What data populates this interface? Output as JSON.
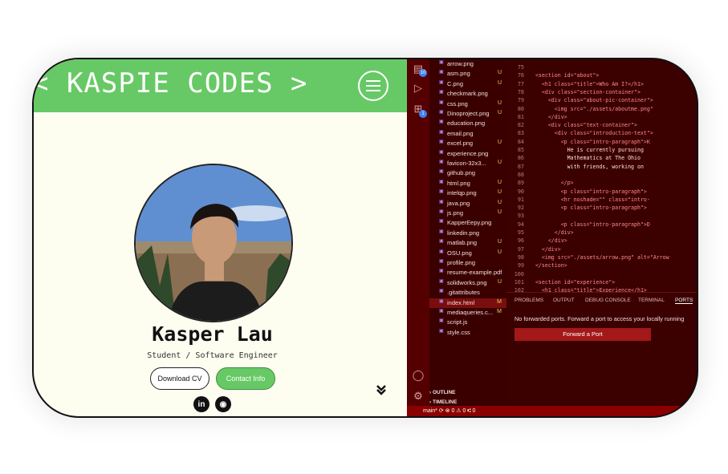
{
  "site": {
    "brand": "< KASPIE CODES >",
    "name": "Kasper Lau",
    "role": "Student / Software Engineer",
    "download_cv": "Download CV",
    "contact": "Contact Info",
    "linkedin": "in",
    "github": "◉",
    "scroll_icon": "⌄⌄"
  },
  "editor": {
    "activity": {
      "explorer_badge": "10",
      "extensions_badge": "1"
    },
    "files": [
      {
        "name": "arrow.png",
        "status": ""
      },
      {
        "name": "asm.png",
        "status": "U"
      },
      {
        "name": "C.png",
        "status": "U"
      },
      {
        "name": "checkmark.png",
        "status": ""
      },
      {
        "name": "css.png",
        "status": "U"
      },
      {
        "name": "Dinoproject.png",
        "status": "U"
      },
      {
        "name": "education.png",
        "status": ""
      },
      {
        "name": "email.png",
        "status": ""
      },
      {
        "name": "excel.png",
        "status": "U"
      },
      {
        "name": "experience.png",
        "status": ""
      },
      {
        "name": "favicon-32x3...",
        "status": "U"
      },
      {
        "name": "github.png",
        "status": ""
      },
      {
        "name": "html.png",
        "status": "U"
      },
      {
        "name": "intelqp.png",
        "status": "U"
      },
      {
        "name": "java.png",
        "status": "U"
      },
      {
        "name": "js.png",
        "status": "U"
      },
      {
        "name": "KapperEepy.png",
        "status": ""
      },
      {
        "name": "linkedin.png",
        "status": ""
      },
      {
        "name": "matlab.png",
        "status": "U"
      },
      {
        "name": "OSU.png",
        "status": "U"
      },
      {
        "name": "profile.png",
        "status": ""
      },
      {
        "name": "resume-example.pdf",
        "status": ""
      },
      {
        "name": "solidworks.png",
        "status": "U"
      },
      {
        "name": ".gitattributes",
        "status": ""
      },
      {
        "name": "index.html",
        "status": "M"
      },
      {
        "name": "mediaqueries.c...",
        "status": "M"
      },
      {
        "name": "script.js",
        "status": ""
      },
      {
        "name": "style.css",
        "status": ""
      }
    ],
    "line_numbers": [
      "75",
      "76",
      "77",
      "78",
      "79",
      "80",
      "81",
      "82",
      "83",
      "84",
      "85",
      "86",
      "87",
      "88",
      "89",
      "90",
      "91",
      "92",
      "93",
      "94",
      "95",
      "96",
      "97",
      "98",
      "99",
      "100",
      "101",
      "102"
    ],
    "code_lines": [
      "",
      "  <section id=\"about\">",
      "    <h1 class=\"title\">Who Am I?</h1>",
      "    <div class=\"section-container\">",
      "      <div class=\"about-pic-container\">",
      "        <img src=\"./assets/aboutme.png\"",
      "      </div>",
      "      <div class=\"text-container\">",
      "        <div class=\"introduction-text\">",
      "          <p class=\"intro-paragraph\">K",
      "            He is currently pursuing",
      "            Mathematics at The Ohio",
      "            with friends, working on",
      "",
      "          </p>",
      "          <p class=\"intro-paragraph\">",
      "          <hr noshade=\"\" class=\"intro-",
      "          <p class=\"intro-paragraph\">",
      "",
      "          <p class=\"intro-paragraph\">D",
      "        </div>",
      "      </div>",
      "    </div>",
      "    <img src=\"./assets/arrow.png\" alt=\"Arrow",
      "  </section>",
      "",
      "  <section id=\"experience\">",
      "    <h1 class=\"title\">Experience</h1>"
    ],
    "panel": {
      "tabs": [
        "PROBLEMS",
        "OUTPUT",
        "DEBUG CONSOLE",
        "TERMINAL",
        "PORTS"
      ],
      "message": "No forwarded ports. Forward a port to access your locally running",
      "button": "Forward a Port"
    },
    "outline": "OUTLINE",
    "timeline": "TIMELINE",
    "status": "main*  ⟳   ⊗ 0  ⚠ 0   ⑆ 0"
  },
  "colors": {
    "header_green": "#67c965",
    "editor_bg": "#3b0000",
    "panel_button": "#a31818"
  }
}
